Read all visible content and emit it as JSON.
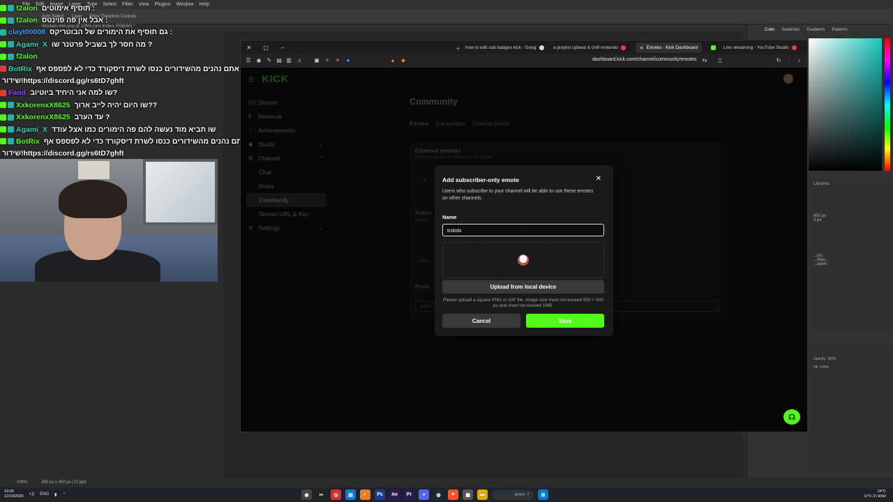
{
  "photoshop": {
    "menu": [
      "File",
      "Edit",
      "Image",
      "Layer",
      "Type",
      "Select",
      "Filter",
      "View",
      "Plugins",
      "Window",
      "Help"
    ],
    "options": [
      "Auto-Select:",
      "Layer",
      "Show Transform Controls"
    ],
    "doc_tab": "5ho3am-mim.png @ 100% (sho trolleo, RGB/8#) *",
    "right_tabs": [
      "Color",
      "Swatches",
      "Gradients",
      "Patterns"
    ],
    "libraries_label": "Libraries",
    "props": [
      "450 px",
      "0 px"
    ],
    "layers_items": [
      "...nts",
      "...ified...",
      "...ayers"
    ],
    "opacity_label": "Opacity:",
    "opacity_value": "100%",
    "fill_label": "Fill:",
    "fill_value": "100%",
    "status_zoom": "100%",
    "status_size": "450 px x 450 px (72 ppi)"
  },
  "chat": [
    {
      "user": "f2alon",
      "msg": "תוסיף אימוטים :",
      "color": "#53fc18",
      "badges": [
        "green",
        "teal"
      ]
    },
    {
      "user": "f2alon",
      "msg": "אבל אין פה פוינטס :",
      "color": "#53fc18",
      "badges": [
        "green",
        "teal"
      ]
    },
    {
      "user": "clayt00008",
      "msg": "גם תוסיף את הימורים של הבוטריקס :",
      "color": "#3aa0ff",
      "badges": [
        "teal"
      ]
    },
    {
      "user": "Agami_X",
      "msg": "מה חסר לך בשביל פרטנר שו ?",
      "color": "#33d4b4",
      "badges": [
        "green",
        "teal"
      ]
    },
    {
      "user": "f2alon",
      "msg": "",
      "color": "#53fc18",
      "badges": [
        "green",
        "teal"
      ]
    },
    {
      "user": "BotRix",
      "msg": "אם אתם נהנים מהשידורים כנסו לשרת דיסקורד כדי לא לפספס אף",
      "color": "#33d4b4",
      "badges": [
        "red"
      ]
    },
    {
      "user": "",
      "msg": "שידור!https://discord.gg/rs6tD7ghft",
      "color": "#fff",
      "badges": []
    },
    {
      "user": "Fand",
      "msg": "שו למה אני היחיד ביוטיוב?",
      "color": "#9147ff",
      "badges": [
        "red"
      ]
    },
    {
      "user": "XxkorenxX8625",
      "msg": "שו היום יהיה לייב ארוך??",
      "color": "#53fc18",
      "badges": [
        "green",
        "teal"
      ]
    },
    {
      "user": "XxkorenxX8625",
      "msg": "עד הערב ?",
      "color": "#53fc18",
      "badges": [
        "green",
        "teal"
      ]
    },
    {
      "user": "Agami_X",
      "msg": "שו תביא מוד נעשה להם פה הימורים כמו אצל עודד",
      "color": "#33d4b4",
      "badges": [
        "green",
        "teal"
      ]
    },
    {
      "user": "BotRix",
      "msg": "אם אתם נהנים מהשידורים כנסו לשרת דיסקורד כדי לא לפספס אף",
      "color": "#53fc18",
      "badges": [
        "green",
        "teal"
      ]
    },
    {
      "user": "",
      "msg": "שידור!https://discord.gg/rs6tD7ghft",
      "color": "#fff",
      "badges": []
    }
  ],
  "browser": {
    "tabs": [
      {
        "label": "how to edit sub badges kick - Goog",
        "active": false,
        "fav": "#4285f4"
      },
      {
        "label": "a playlist upbeat & chill nintendo",
        "active": false,
        "fav": "#ff0000"
      },
      {
        "label": "Emotes - Kick Dashboard",
        "active": true,
        "fav": "#53fc18"
      },
      {
        "label": "Live streaming - YouTube Studio",
        "active": false,
        "fav": "#ff0000"
      }
    ],
    "url": "dashboard.kick.com/channel/community/emotes"
  },
  "kick": {
    "logo": "KICK",
    "sidebar": [
      {
        "label": "Stream",
        "icon": "((•))",
        "sub": false,
        "chevron": ""
      },
      {
        "label": "Revenue",
        "icon": "$",
        "sub": false,
        "chevron": ""
      },
      {
        "label": "Achievements",
        "icon": "☆",
        "sub": false,
        "chevron": ""
      },
      {
        "label": "Studio",
        "icon": "▣",
        "sub": false,
        "chevron": "⌄"
      },
      {
        "label": "Channel",
        "icon": "▤",
        "sub": false,
        "chevron": "⌃"
      },
      {
        "label": "Chat",
        "icon": "",
        "sub": true,
        "chevron": ""
      },
      {
        "label": "Roles",
        "icon": "",
        "sub": true,
        "chevron": ""
      },
      {
        "label": "Community",
        "icon": "",
        "sub": true,
        "chevron": "",
        "active": true
      },
      {
        "label": "Stream URL & Key",
        "icon": "",
        "sub": true,
        "chevron": ""
      },
      {
        "label": "Settings",
        "icon": "⚙",
        "sub": false,
        "chevron": "⌄"
      }
    ],
    "title": "Community",
    "tabs": [
      "Emotes",
      "Sub badges",
      "Channel points"
    ],
    "panel_title": "Channel emotes",
    "panel_sub": "Up to 60 emotes are allowed to be added",
    "ghost_sub": "Subsc",
    "ghost_count": "56/63 s",
    "ghost_user": "romfy",
    "ghost_prefix": "Prefix",
    "prefix_value": "shotik"
  },
  "modal": {
    "title": "Add subscriber-only emote",
    "description": "Users who subscribe to your channel will be able to use these emotes on other channels.",
    "name_label": "Name",
    "name_value": "trololo",
    "upload_label": "Upload from local device",
    "hint": "Please upload a square PNG or GIF file. Image size must not exceed 500 × 500 px and must not exceed 1MB.",
    "cancel_label": "Cancel",
    "save_label": "Save"
  },
  "taskbar": {
    "time": "10:06",
    "date": "12/10/2025",
    "lang": "ENG",
    "search_label": "חיפוש",
    "temp": "24°C",
    "weather": "שמש רב חיים"
  },
  "colors": {
    "kick_green": "#53fc18",
    "modal_bg": "#1a1a1a"
  }
}
